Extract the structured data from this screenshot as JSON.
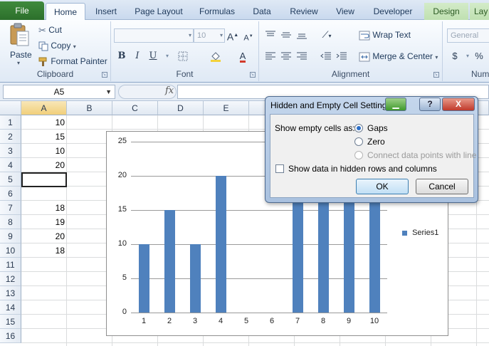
{
  "ribbon": {
    "tabs": [
      {
        "label": "File"
      },
      {
        "label": "Home"
      },
      {
        "label": "Insert"
      },
      {
        "label": "Page Layout"
      },
      {
        "label": "Formulas"
      },
      {
        "label": "Data"
      },
      {
        "label": "Review"
      },
      {
        "label": "View"
      },
      {
        "label": "Developer"
      },
      {
        "label": "Design"
      },
      {
        "label": "Lay"
      }
    ],
    "clipboard": {
      "title": "Clipboard",
      "paste": "Paste",
      "cut": "Cut",
      "copy": "Copy",
      "format_painter": "Format Painter"
    },
    "font": {
      "title": "Font",
      "font_name": "",
      "font_size": "10",
      "bold": "B",
      "italic": "I",
      "underline": "U"
    },
    "alignment": {
      "title": "Alignment",
      "wrap_text": "Wrap Text",
      "merge_center": "Merge & Center"
    },
    "number": {
      "title": "Num",
      "format": "General",
      "currency": "$",
      "percent": "%"
    }
  },
  "formula_bar": {
    "name_box": "A5",
    "fx": "fx",
    "value": ""
  },
  "sheet": {
    "columns": [
      "A",
      "B",
      "C",
      "D",
      "E"
    ],
    "rows": [
      "1",
      "2",
      "3",
      "4",
      "5",
      "6",
      "7",
      "8",
      "9",
      "10",
      "11",
      "12",
      "13",
      "14",
      "15",
      "16"
    ],
    "cells_a": [
      "10",
      "15",
      "10",
      "20",
      "",
      "",
      "18",
      "19",
      "20",
      "18",
      "",
      "",
      "",
      "",
      "",
      ""
    ]
  },
  "chart_data": {
    "type": "bar",
    "categories": [
      "1",
      "2",
      "3",
      "4",
      "5",
      "6",
      "7",
      "8",
      "9",
      "10"
    ],
    "series": [
      {
        "name": "Series1",
        "values": [
          10,
          15,
          10,
          20,
          null,
          null,
          18,
          19,
          20,
          18
        ]
      }
    ],
    "ylim": [
      0,
      25
    ],
    "yticks": [
      "0",
      "5",
      "10",
      "15",
      "20",
      "25"
    ],
    "grid": true,
    "legend_position": "right"
  },
  "dialog": {
    "title": "Hidden and Empty Cell Settings",
    "show_empty_label": "Show empty cells as:",
    "options": {
      "gaps": "Gaps",
      "zero": "Zero",
      "connect": "Connect data points with line"
    },
    "selected_option": "Gaps",
    "show_hidden_label": "Show data in hidden rows and columns",
    "ok": "OK",
    "cancel": "Cancel",
    "help": "?",
    "close": "X"
  }
}
